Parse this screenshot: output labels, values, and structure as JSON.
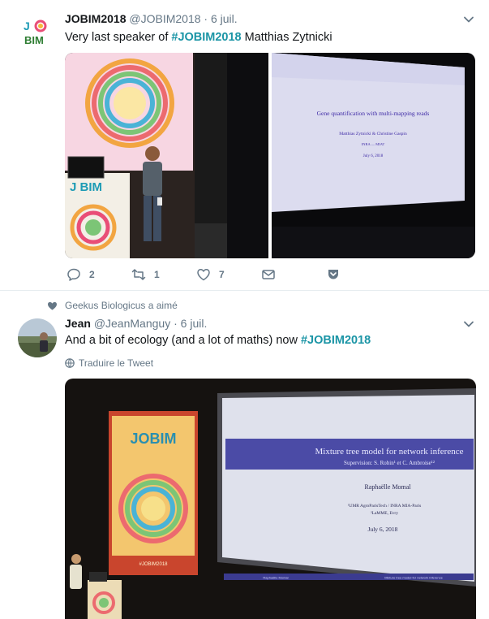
{
  "tweets": [
    {
      "name": "JOBIM2018",
      "handle": "@JOBIM2018",
      "sep": "·",
      "date": "6 juil.",
      "text_prefix": "Very last speaker of ",
      "hashtag": "#JOBIM2018",
      "text_suffix": " Matthias Zytnicki",
      "avatar_logo_top": "J",
      "avatar_logo_bottom": "BIM",
      "media": {
        "banner_logo": "J BIM",
        "slide_title": "Gene quantification with multi-mapping reads",
        "slide_authors": "Matthias Zytnicki & Christine Gaspin",
        "slide_affil": "INRA — MIAT",
        "slide_date": "July 6, 2018"
      },
      "actions": {
        "replies": "2",
        "retweets": "1",
        "likes": "7"
      }
    },
    {
      "social_context": "Geekus Biologicus a aimé",
      "name": "Jean",
      "handle": "@JeanManguy",
      "sep": "·",
      "date": "6 juil.",
      "text_prefix": "And a bit of ecology (and a lot of maths) now ",
      "hashtag": "#JOBIM2018",
      "translate": "Traduire le Tweet",
      "media": {
        "banner_logo": "JOBIM",
        "banner_sub": "#JOBIM2018",
        "slide_title": "Mixture tree model for network inference",
        "slide_supervision": "Supervision: S. Robin¹ et C. Ambroise¹²",
        "slide_author": "Raphaëlle Momal",
        "slide_affil1": "¹UMR AgroParisTech / INRA MIA-Paris",
        "slide_affil2": "²LaMME, Evry",
        "slide_date": "July 6, 2018",
        "footer_left": "Raphaëlle Momal",
        "footer_right": "Mixture tree model for network inference"
      }
    }
  ],
  "colors": {
    "hashtag": "#1b95a6",
    "muted": "#657786",
    "border": "#e6ecf0"
  }
}
